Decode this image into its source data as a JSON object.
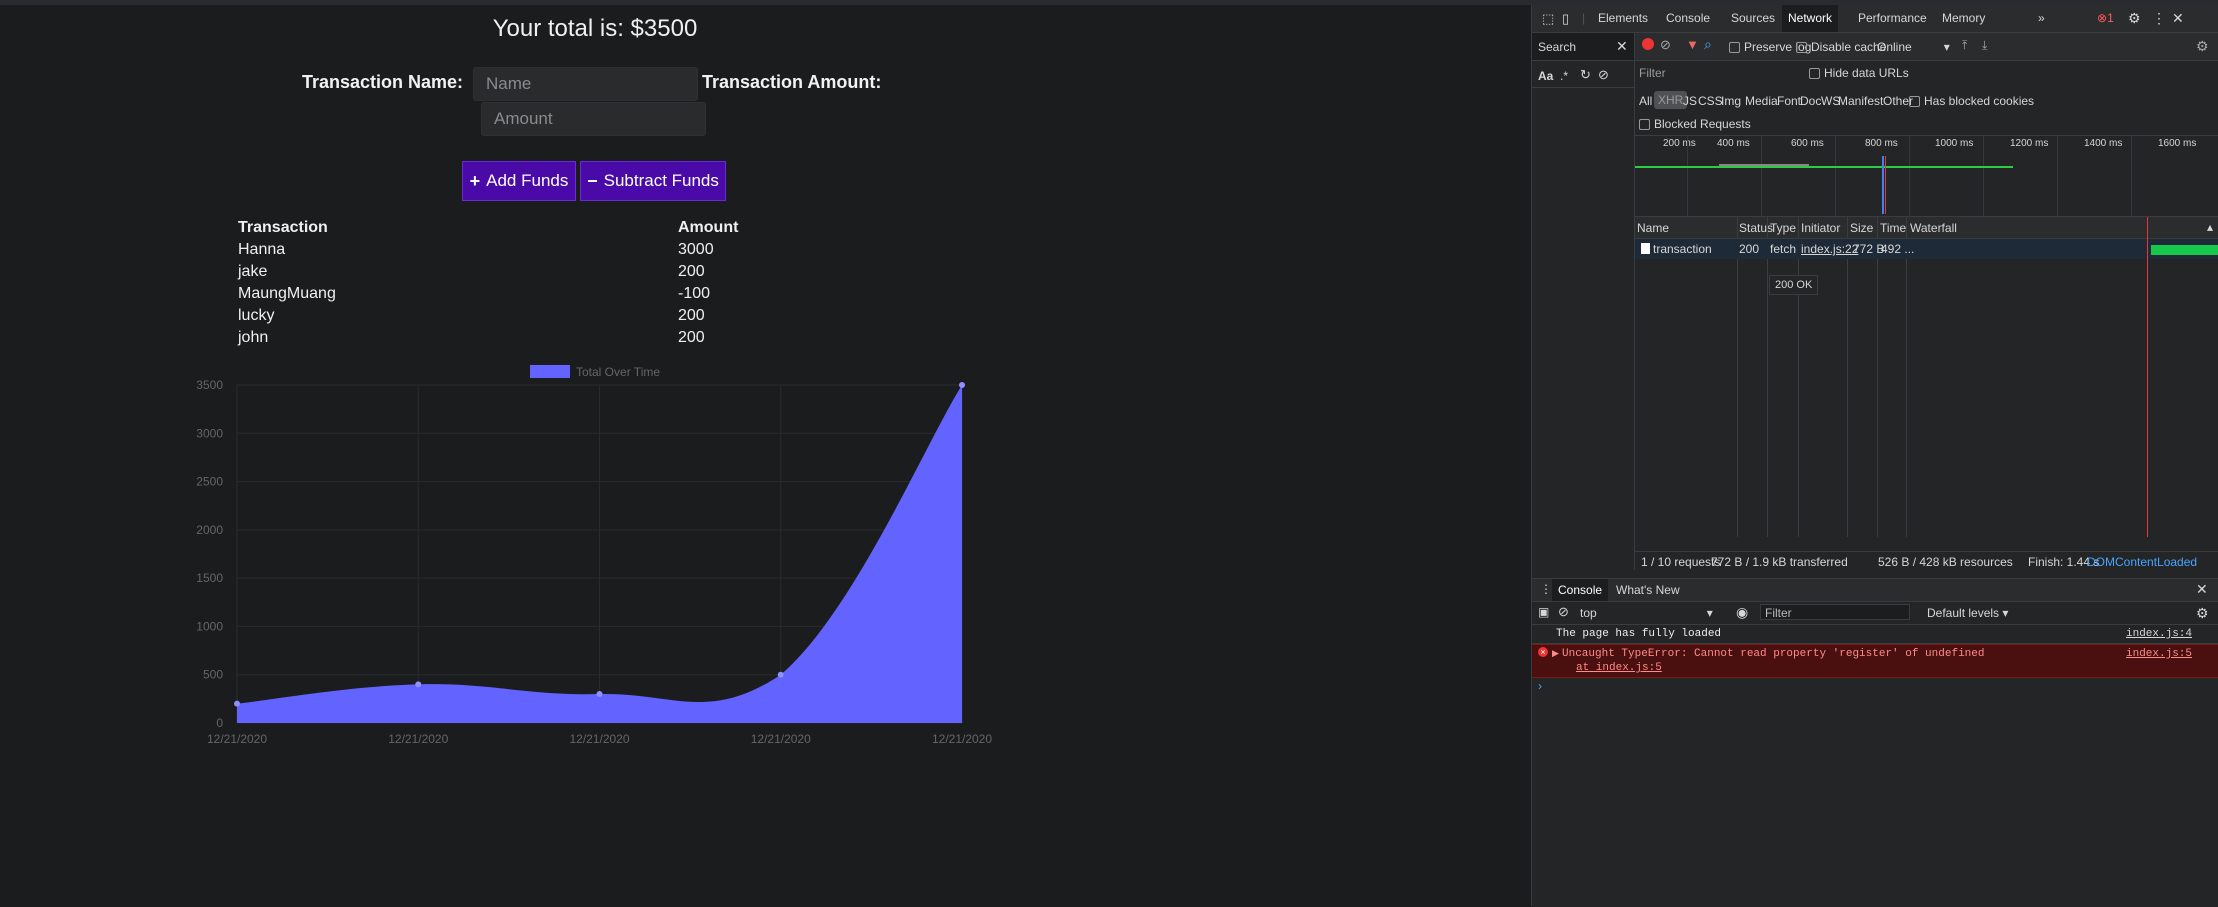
{
  "app": {
    "total_text": "Your total is: $3500",
    "name_label": "Transaction Name:",
    "name_placeholder": "Name",
    "amount_label": "Transaction Amount:",
    "amount_placeholder": "Amount",
    "add_label": "Add Funds",
    "subtract_label": "Subtract Funds",
    "table": {
      "headers": [
        "Transaction",
        "Amount"
      ],
      "rows": [
        [
          "Hanna",
          "3000"
        ],
        [
          "jake",
          "200"
        ],
        [
          "MaungMuang",
          "-100"
        ],
        [
          "lucky",
          "200"
        ],
        [
          "john",
          "200"
        ]
      ]
    },
    "colors": {
      "accent": "#4a0aa8",
      "area": "#6363ff",
      "bg": "#1b1c1e"
    }
  },
  "chart_data": {
    "type": "area",
    "legend": "Total Over Time",
    "x": [
      "12/21/2020",
      "12/21/2020",
      "12/21/2020",
      "12/21/2020",
      "12/21/2020"
    ],
    "series": [
      {
        "name": "Total Over Time",
        "values": [
          200,
          400,
          300,
          500,
          3500
        ]
      }
    ],
    "ylim": [
      0,
      3500
    ],
    "y_ticks": [
      "0",
      "500",
      "1000",
      "1500",
      "2000",
      "2500",
      "3000",
      "3500"
    ],
    "legend_position": "top"
  },
  "devtools": {
    "tabs": [
      "Elements",
      "Console",
      "Sources",
      "Network",
      "Performance",
      "Memory"
    ],
    "active_tab": "Network",
    "more": "»",
    "error_count": "1",
    "search_label": "Search",
    "preserve_log": "Preserve log",
    "disable_cache": "Disable cache",
    "throttle": "Online",
    "filter_placeholder": "Filter",
    "hide_data_urls": "Hide data URLs",
    "type_filters": [
      "All",
      "XHR",
      "JS",
      "CSS",
      "Img",
      "Media",
      "Font",
      "Doc",
      "WS",
      "Manifest",
      "Other"
    ],
    "has_blocked_cookies": "Has blocked cookies",
    "blocked_requests": "Blocked Requests",
    "timeline_ticks": [
      "200 ms",
      "400 ms",
      "600 ms",
      "800 ms",
      "1000 ms",
      "1200 ms",
      "1400 ms",
      "1600 ms"
    ],
    "columns": [
      "Name",
      "Status",
      "Type",
      "Initiator",
      "Size",
      "Time",
      "Waterfall"
    ],
    "request": {
      "name": "transaction",
      "status": "200",
      "type": "fetch",
      "initiator": "index.js:22",
      "size": "772 B",
      "time": "492 ..."
    },
    "tooltip": "200 OK",
    "summary": {
      "requests": "1 / 10 requests",
      "transferred": "772 B / 1.9 kB transferred",
      "resources": "526 B / 428 kB resources",
      "finish": "Finish: 1.44 s",
      "dcl": "DOMContentLoaded"
    },
    "console": {
      "tabs": [
        "Console",
        "What's New"
      ],
      "context": "top",
      "filter_placeholder": "Filter",
      "levels": "Default levels",
      "messages": [
        {
          "text": "The page has fully loaded",
          "source": "index.js:4",
          "level": "log"
        },
        {
          "text": "Uncaught TypeError: Cannot read property 'register' of undefined",
          "sub": "at index.js:5",
          "source": "index.js:5",
          "level": "error"
        }
      ],
      "prompt": "›"
    }
  }
}
